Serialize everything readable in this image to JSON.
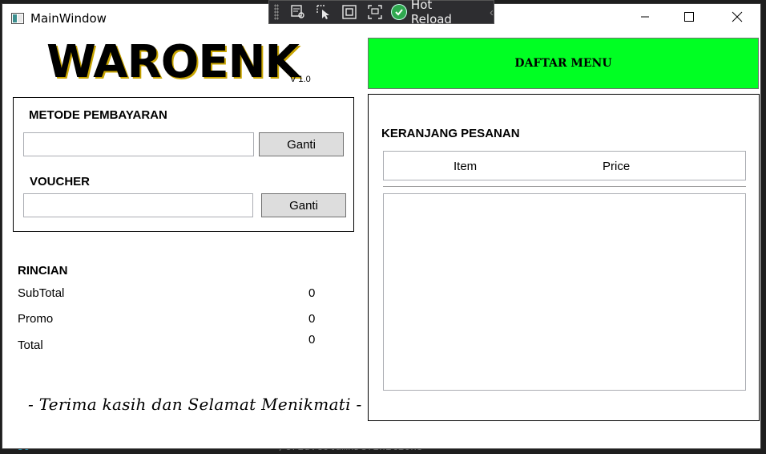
{
  "window": {
    "title": "MainWindow",
    "controls": {
      "minimize": "minimize-icon",
      "maximize": "maximize-icon",
      "close": "close-icon"
    }
  },
  "hot_reload_toolbar": {
    "label": "Hot Reload",
    "tools": [
      "select-element-icon",
      "pointer-select-icon",
      "display-layout-adorners-icon",
      "track-focus-icon"
    ],
    "status_color": "#2fa84f"
  },
  "header": {
    "logo": "WAROENK",
    "version": "V 1.0"
  },
  "menu_button": {
    "label": "DAFTAR MENU",
    "color": "#00ff23"
  },
  "payment": {
    "method_label": "METODE PEMBAYARAN",
    "method_value": "",
    "method_button": "Ganti",
    "voucher_label": "VOUCHER",
    "voucher_value": "",
    "voucher_button": "Ganti"
  },
  "rincian": {
    "title": "RINCIAN",
    "rows": [
      {
        "label": "SubTotal",
        "value": "0"
      },
      {
        "label": "Promo",
        "value": "0"
      },
      {
        "label": "Total",
        "value": "0"
      }
    ]
  },
  "footer_message": "- Terima kasih dan Selamat Menikmati -",
  "cart": {
    "title": "KERANJANG PESANAN",
    "columns": [
      "Item",
      "Price"
    ],
    "items": []
  },
  "background_editor": {
    "code_line": "</Grid.ColumnDefinitions>",
    "line_number": "59"
  }
}
